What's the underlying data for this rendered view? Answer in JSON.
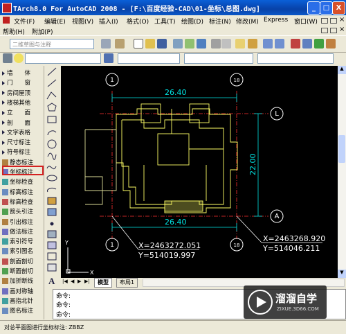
{
  "window": {
    "title": "TArch8.0 For AutoCAD 2008 - [F:\\百度经验-CAD\\01-坐标\\总图.dwg]",
    "min_label": "_",
    "max_label": "□",
    "close_label": "X"
  },
  "menubar": {
    "items": [
      "文件(F)",
      "编辑(E)",
      "视图(V)",
      "插入(I)",
      "格式(O)",
      "工具(T)",
      "绘图(D)",
      "标注(N)",
      "修改(M)",
      "Express",
      "窗口(W)"
    ],
    "items2": [
      "帮助(H)",
      "附加(P)"
    ]
  },
  "toolbar": {
    "layer_combo": "二维草图与注释"
  },
  "tianzheng_panel": {
    "items": [
      {
        "label": "墙　　体",
        "type": "arrow"
      },
      {
        "label": "门　　窗",
        "type": "arrow"
      },
      {
        "label": "房间屋顶",
        "type": "arrow"
      },
      {
        "label": "楼梯其他",
        "type": "arrow"
      },
      {
        "label": "立　　面",
        "type": "arrow"
      },
      {
        "label": "剖　　面",
        "type": "arrow"
      },
      {
        "label": "文字表格",
        "type": "arrow"
      },
      {
        "label": "尺寸标注",
        "type": "arrow"
      },
      {
        "label": "符号标注",
        "type": "arrow"
      },
      {
        "label": "静态标注",
        "type": "icon"
      },
      {
        "label": "坐标标注",
        "type": "icon"
      },
      {
        "label": "坐标检查",
        "type": "icon"
      },
      {
        "label": "标高标注",
        "type": "icon"
      },
      {
        "label": "标高检查",
        "type": "icon"
      },
      {
        "label": "箭头引注",
        "type": "icon"
      },
      {
        "label": "引出标注",
        "type": "icon"
      },
      {
        "label": "做法标注",
        "type": "icon"
      },
      {
        "label": "索引符号",
        "type": "icon"
      },
      {
        "label": "索引图名",
        "type": "icon"
      },
      {
        "label": "剖面剖切",
        "type": "icon"
      },
      {
        "label": "断面剖切",
        "type": "icon"
      },
      {
        "label": "加折断线",
        "type": "icon"
      },
      {
        "label": "画对称轴",
        "type": "icon"
      },
      {
        "label": "画指北针",
        "type": "icon"
      },
      {
        "label": "图名标注",
        "type": "icon"
      }
    ],
    "selected": "坐标标注"
  },
  "drawing": {
    "dim_top": "26.40",
    "dim_bottom": "26.40",
    "dim_right": "22.00",
    "axis_1_top": "1",
    "axis_18_top": "18",
    "axis_L": "L",
    "axis_A": "A",
    "axis_1_bottom": "1",
    "axis_18_bottom": "18",
    "coord1_x": "X=2463272.051",
    "coord1_y": "Y=514019.997",
    "coord2_x": "X=2463268.920",
    "coord2_y": "Y=514046.211",
    "ucs_x": "X",
    "ucs_y": "Y"
  },
  "tabs": [
    "模型",
    "布局1"
  ],
  "command": {
    "line1": "命令:",
    "line2": "命令:",
    "line3": "命令:"
  },
  "status": "对总平面图进行坐标标注: ZBBZ",
  "watermark": {
    "cn": "溜溜自学",
    "en": "ZIXUE.3D66.COM"
  },
  "colors": {
    "titlebar": "#0a5fd8",
    "canvas": "#000000",
    "dim": "#00e5e5",
    "building": "#ffff66",
    "axis": "#ff3030",
    "highlight": "#d42020"
  }
}
